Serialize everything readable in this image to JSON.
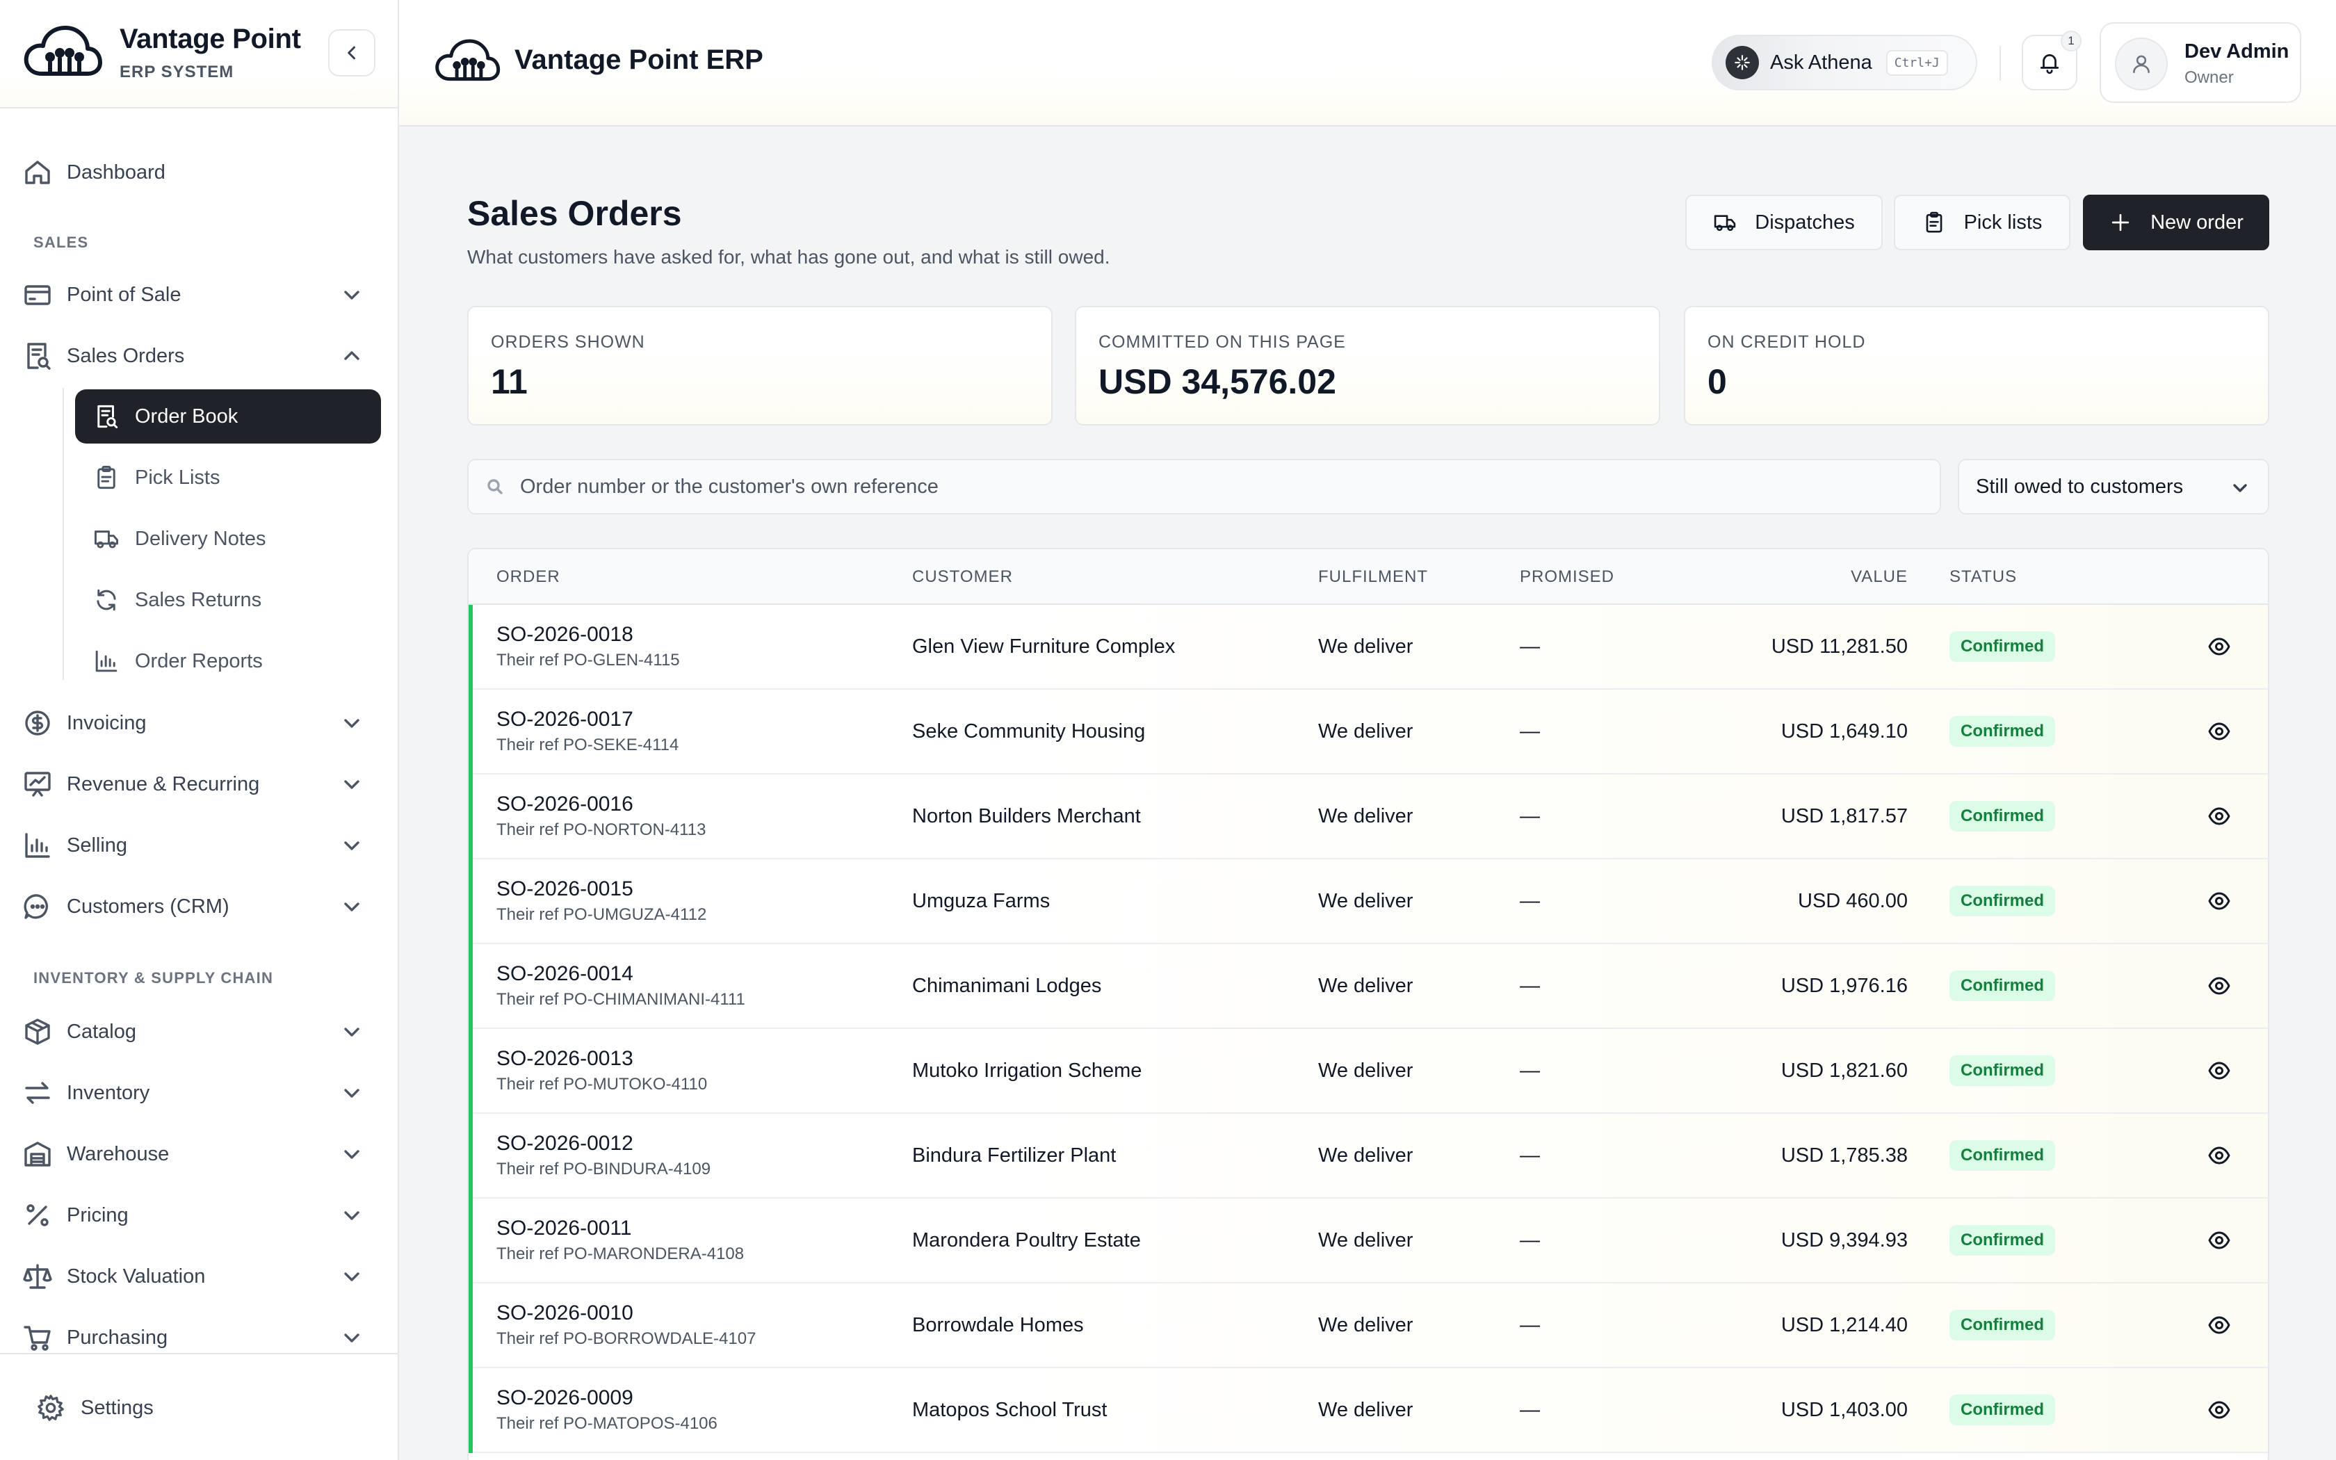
{
  "brand": {
    "name": "Vantage Point",
    "subtitle": "ERP SYSTEM"
  },
  "header": {
    "title": "Vantage Point ERP",
    "ask_label": "Ask Athena",
    "ask_shortcut": "Ctrl+J",
    "notifications": "1",
    "user": {
      "name": "Dev Admin",
      "role": "Owner"
    }
  },
  "sidebar": {
    "dashboard": "Dashboard",
    "section_sales": "SALES",
    "point_of_sale": "Point of Sale",
    "sales_orders": "Sales Orders",
    "sub": {
      "order_book": "Order Book",
      "pick_lists": "Pick Lists",
      "delivery_notes": "Delivery Notes",
      "sales_returns": "Sales Returns",
      "order_reports": "Order Reports"
    },
    "invoicing": "Invoicing",
    "revenue": "Revenue & Recurring",
    "selling": "Selling",
    "crm": "Customers (CRM)",
    "section_inventory": "INVENTORY & SUPPLY CHAIN",
    "catalog": "Catalog",
    "inventory": "Inventory",
    "warehouse": "Warehouse",
    "pricing": "Pricing",
    "stock_valuation": "Stock Valuation",
    "purchasing": "Purchasing",
    "settings": "Settings"
  },
  "page": {
    "title": "Sales Orders",
    "subtitle": "What customers have asked for, what has gone out, and what is still owed.",
    "buttons": {
      "dispatches": "Dispatches",
      "pick_lists": "Pick lists",
      "new_order": "New order"
    }
  },
  "stats": {
    "orders_shown": {
      "label": "ORDERS SHOWN",
      "value": "11"
    },
    "committed": {
      "label": "COMMITTED ON THIS PAGE",
      "value": "USD 34,576.02"
    },
    "credit_hold": {
      "label": "ON CREDIT HOLD",
      "value": "0"
    }
  },
  "filters": {
    "search_placeholder": "Order number or the customer's own reference",
    "status_filter": "Still owed to customers"
  },
  "table": {
    "headers": {
      "order": "ORDER",
      "customer": "CUSTOMER",
      "fulfilment": "FULFILMENT",
      "promised": "PROMISED",
      "value": "VALUE",
      "status": "STATUS"
    },
    "rows": [
      {
        "order": "SO-2026-0018",
        "ref": "Their ref PO-GLEN-4115",
        "customer": "Glen View Furniture Complex",
        "fulfilment": "We deliver",
        "promised": "—",
        "value": "USD 11,281.50",
        "status": "Confirmed"
      },
      {
        "order": "SO-2026-0017",
        "ref": "Their ref PO-SEKE-4114",
        "customer": "Seke Community Housing",
        "fulfilment": "We deliver",
        "promised": "—",
        "value": "USD 1,649.10",
        "status": "Confirmed"
      },
      {
        "order": "SO-2026-0016",
        "ref": "Their ref PO-NORTON-4113",
        "customer": "Norton Builders Merchant",
        "fulfilment": "We deliver",
        "promised": "—",
        "value": "USD 1,817.57",
        "status": "Confirmed"
      },
      {
        "order": "SO-2026-0015",
        "ref": "Their ref PO-UMGUZA-4112",
        "customer": "Umguza Farms",
        "fulfilment": "We deliver",
        "promised": "—",
        "value": "USD 460.00",
        "status": "Confirmed"
      },
      {
        "order": "SO-2026-0014",
        "ref": "Their ref PO-CHIMANIMANI-4111",
        "customer": "Chimanimani Lodges",
        "fulfilment": "We deliver",
        "promised": "—",
        "value": "USD 1,976.16",
        "status": "Confirmed"
      },
      {
        "order": "SO-2026-0013",
        "ref": "Their ref PO-MUTOKO-4110",
        "customer": "Mutoko Irrigation Scheme",
        "fulfilment": "We deliver",
        "promised": "—",
        "value": "USD 1,821.60",
        "status": "Confirmed"
      },
      {
        "order": "SO-2026-0012",
        "ref": "Their ref PO-BINDURA-4109",
        "customer": "Bindura Fertilizer Plant",
        "fulfilment": "We deliver",
        "promised": "—",
        "value": "USD 1,785.38",
        "status": "Confirmed"
      },
      {
        "order": "SO-2026-0011",
        "ref": "Their ref PO-MARONDERA-4108",
        "customer": "Marondera Poultry Estate",
        "fulfilment": "We deliver",
        "promised": "—",
        "value": "USD 9,394.93",
        "status": "Confirmed"
      },
      {
        "order": "SO-2026-0010",
        "ref": "Their ref PO-BORROWDALE-4107",
        "customer": "Borrowdale Homes",
        "fulfilment": "We deliver",
        "promised": "—",
        "value": "USD 1,214.40",
        "status": "Confirmed"
      },
      {
        "order": "SO-2026-0009",
        "ref": "Their ref PO-MATOPOS-4106",
        "customer": "Matopos School Trust",
        "fulfilment": "We deliver",
        "promised": "—",
        "value": "USD 1,403.00",
        "status": "Confirmed"
      }
    ]
  },
  "colors": {
    "accent_dark": "#1f2329",
    "status_bar": "#22c55e",
    "confirmed_bg": "#dcfce7",
    "confirmed_text": "#15803d"
  },
  "icons": {
    "brand": "cloud-people-logo",
    "collapse": "chevron-left-icon",
    "dashboard": "home-icon",
    "pos": "credit-card-icon",
    "sales_orders": "receipt-search-icon",
    "invoicing": "dollar-circle-icon",
    "revenue": "chart-presentation-icon",
    "selling": "bar-chart-icon",
    "crm": "chat-dots-icon",
    "catalog": "box-icon",
    "inventory": "arrows-swap-icon",
    "warehouse": "warehouse-icon",
    "pricing": "percent-icon",
    "stock_valuation": "scale-icon",
    "purchasing": "cart-icon",
    "settings": "gear-icon",
    "bell": "bell-icon",
    "user": "user-icon",
    "eye": "eye-icon",
    "search": "search-icon"
  }
}
